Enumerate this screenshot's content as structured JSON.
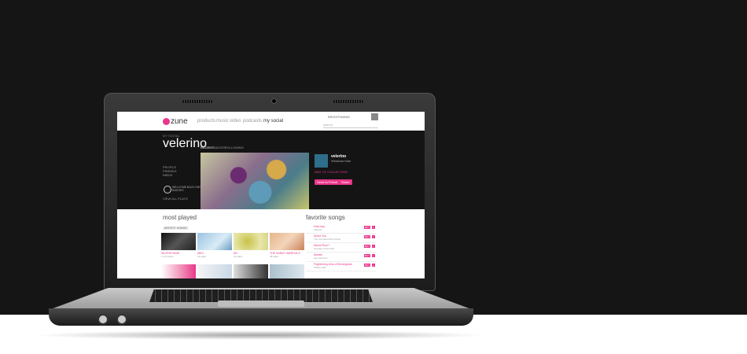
{
  "app": {
    "logo": "zune"
  },
  "nav": [
    "products",
    "music",
    "video",
    "podcasts",
    "my social"
  ],
  "header": {
    "search_placeholder": "search",
    "user": "BRIGHTMANIA"
  },
  "profile": {
    "label": "MY SOCIAL",
    "name": "velerino",
    "side_links": [
      "PROFILE",
      "FRIENDS",
      "INBOX"
    ],
    "badge": "WELCOME BACK! NEW BADGES",
    "view_all": "VIEW ALL PLAYS",
    "tabs": [
      "RECENT",
      "BADGES",
      "FOLLOWING"
    ]
  },
  "now_playing": {
    "title": "velerino",
    "subtitle": "Windows Kids",
    "link": "ADD TO COLLECTION",
    "buttons": [
      "Send to Friend",
      "Share"
    ]
  },
  "most_played": {
    "title": "most played",
    "tabs": [
      "ARTISTS",
      "SONGS"
    ],
    "albums": [
      {
        "name": "SILVERCHAIR",
        "plays": "1,172 plays"
      },
      {
        "name": "MEG",
        "plays": "43 plays"
      },
      {
        "name": "MC",
        "plays": "41 plays"
      },
      {
        "name": "THE DANDY WARHOLS",
        "plays": "38 plays"
      }
    ]
  },
  "favorite_songs": {
    "title": "favorite songs",
    "songs": [
      {
        "title": "Hold Iray",
        "artist": "Adeneo"
      },
      {
        "title": "About You",
        "artist": "The Cat Hand Nice Chips"
      },
      {
        "title": "Would Rum?",
        "artist": "Average Chemicals"
      },
      {
        "title": "Mozzie",
        "artist": "Jay Giovanni"
      },
      {
        "title": "Frightening Jess of Birmingham",
        "artist": "Winkel Kids"
      }
    ],
    "buttons": [
      "BUY",
      "+"
    ]
  },
  "colors": {
    "accent": "#e9368b",
    "background": "#151515"
  }
}
